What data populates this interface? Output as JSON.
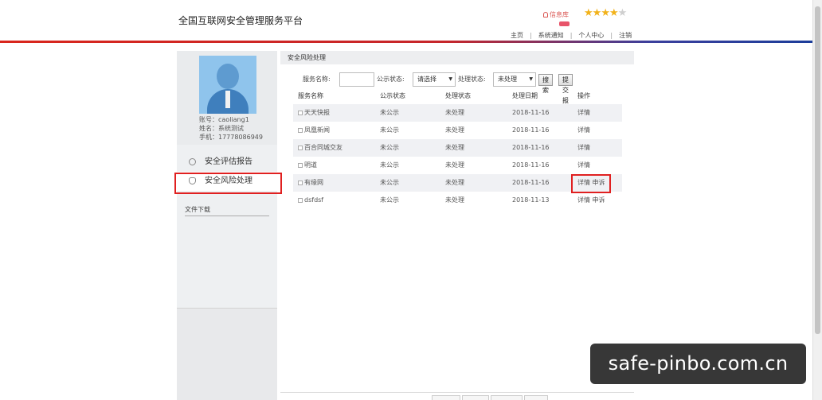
{
  "header": {
    "site_title": "全国互联网安全管理服务平台",
    "user_link": "信息库",
    "rating_stars_filled": 4,
    "rating_stars_total": 5,
    "nav": [
      "主页",
      "系统通知",
      "个人中心",
      "注销"
    ],
    "accent_color": "#d9261c"
  },
  "sidebar": {
    "account": "账号：caoliang1",
    "name": "姓名：系统测试",
    "phone": "手机：17778086949",
    "menu": [
      {
        "label": "安全评估报告",
        "icon": "search-icon"
      },
      {
        "label": "安全风险处理",
        "icon": "shield-icon"
      }
    ],
    "files_label": "文件下载"
  },
  "main": {
    "panel_title": "安全风险处理",
    "filters": {
      "service_name_label": "服务名称:",
      "service_name_value": "",
      "public_status_label": "公示状态:",
      "public_status_value": "请选择",
      "process_status_label": "处理状态:",
      "process_status_value": "未处理",
      "search_button": "搜索",
      "submit_report_button": "提交报告"
    },
    "table": {
      "columns": [
        "服务名称",
        "公示状态",
        "处理状态",
        "处理日期",
        "操作"
      ],
      "rows": [
        {
          "name": "天天快报",
          "public": "未公示",
          "status": "未处理",
          "date": "2018-11-16",
          "ops": "详情"
        },
        {
          "name": "凤凰新闻",
          "public": "未公示",
          "status": "未处理",
          "date": "2018-11-16",
          "ops": "详情"
        },
        {
          "name": "百合同城交友",
          "public": "未公示",
          "status": "未处理",
          "date": "2018-11-16",
          "ops": "详情"
        },
        {
          "name": "明道",
          "public": "未公示",
          "status": "未处理",
          "date": "2018-11-16",
          "ops": "详情"
        },
        {
          "name": "有缘网",
          "public": "未公示",
          "status": "未处理",
          "date": "2018-11-16",
          "ops": "详情 申诉"
        },
        {
          "name": "dsfdsf",
          "public": "未公示",
          "status": "未处理",
          "date": "2018-11-13",
          "ops": "详情 申诉"
        }
      ]
    }
  },
  "watermark": "safe-pinbo.com.cn"
}
